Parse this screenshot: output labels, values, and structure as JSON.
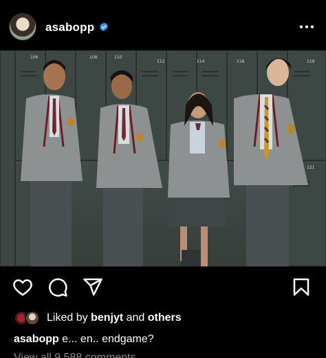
{
  "post": {
    "username": "asabopp",
    "verified_icon": "verified-badge-icon",
    "more_icon": "more-options-icon"
  },
  "photo": {
    "alt_subject": "four students in grey school uniforms leaning against lockers",
    "locker_numbers": [
      "106",
      "108",
      "110",
      "112",
      "114",
      "116",
      "119",
      "121"
    ]
  },
  "actions": {
    "icons": [
      "heart-icon",
      "comment-icon",
      "share-icon",
      "bookmark-icon"
    ]
  },
  "likes": {
    "prefix": "Liked by",
    "user": "benjyt",
    "connector": "and",
    "others": "others"
  },
  "caption": {
    "username": "asabopp",
    "text": "e... en.. endgame?"
  },
  "comments": {
    "label": "View all 9,588 comments"
  },
  "colors": {
    "background": "#000000",
    "text": "#ffffff",
    "verified": "#3897f0",
    "muted": "#8e8e8e"
  }
}
